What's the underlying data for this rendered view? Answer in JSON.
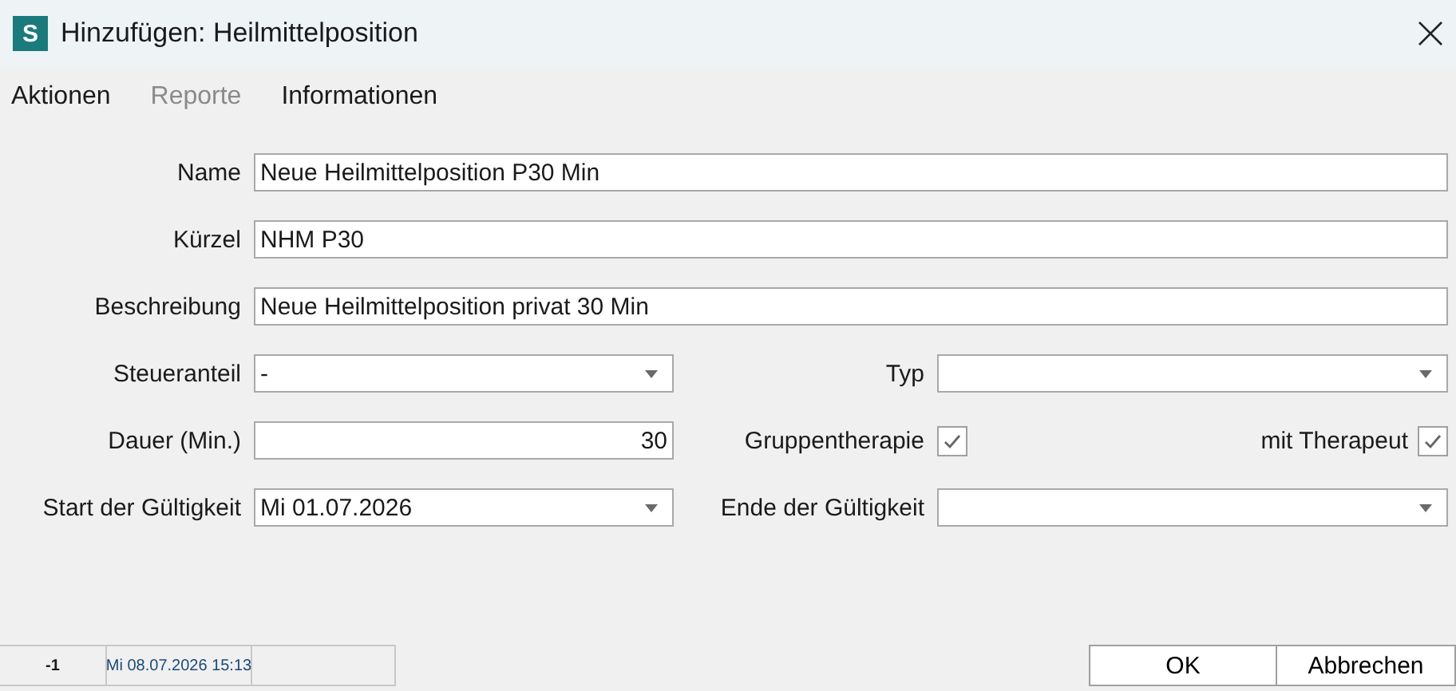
{
  "window": {
    "icon_letter": "S",
    "title": "Hinzufügen: Heilmittelposition"
  },
  "menu": [
    {
      "label": "Aktionen",
      "disabled": false
    },
    {
      "label": "Reporte",
      "disabled": true
    },
    {
      "label": "Informationen",
      "disabled": false
    }
  ],
  "form": {
    "rows": [
      {
        "fields": [
          {
            "kind": "text",
            "label": "Name",
            "value": "Neue Heilmittelposition P30 Min"
          }
        ]
      },
      {
        "fields": [
          {
            "kind": "text",
            "label": "Kürzel",
            "value": "NHM P30"
          }
        ]
      },
      {
        "fields": [
          {
            "kind": "text",
            "label": "Beschreibung",
            "value": "Neue Heilmittelposition privat 30 Min"
          }
        ]
      },
      {
        "fields": [
          {
            "kind": "dropdown",
            "label": "Steueranteil",
            "value": "-"
          },
          {
            "kind": "dropdown",
            "label": "Typ"
          }
        ]
      },
      {
        "fields": [
          {
            "kind": "number",
            "label": "Dauer (Min.)",
            "value": "30"
          },
          {
            "kind": "checkbox",
            "label": "Gruppentherapie",
            "checked": true
          },
          {
            "kind": "checkbox",
            "label": "mit Therapeut",
            "checked": true
          }
        ]
      },
      {
        "fields": [
          {
            "kind": "dropdown",
            "label": "Start der Gültigkeit",
            "value": "Mi 01.07.2026"
          },
          {
            "kind": "dropdown",
            "label": "Ende der Gültigkeit"
          }
        ]
      }
    ]
  },
  "status_bar": {
    "cells": [
      "-1",
      "Mi 08.07.2026 15:13",
      ""
    ]
  },
  "buttons": [
    "OK",
    "Abbrechen"
  ]
}
